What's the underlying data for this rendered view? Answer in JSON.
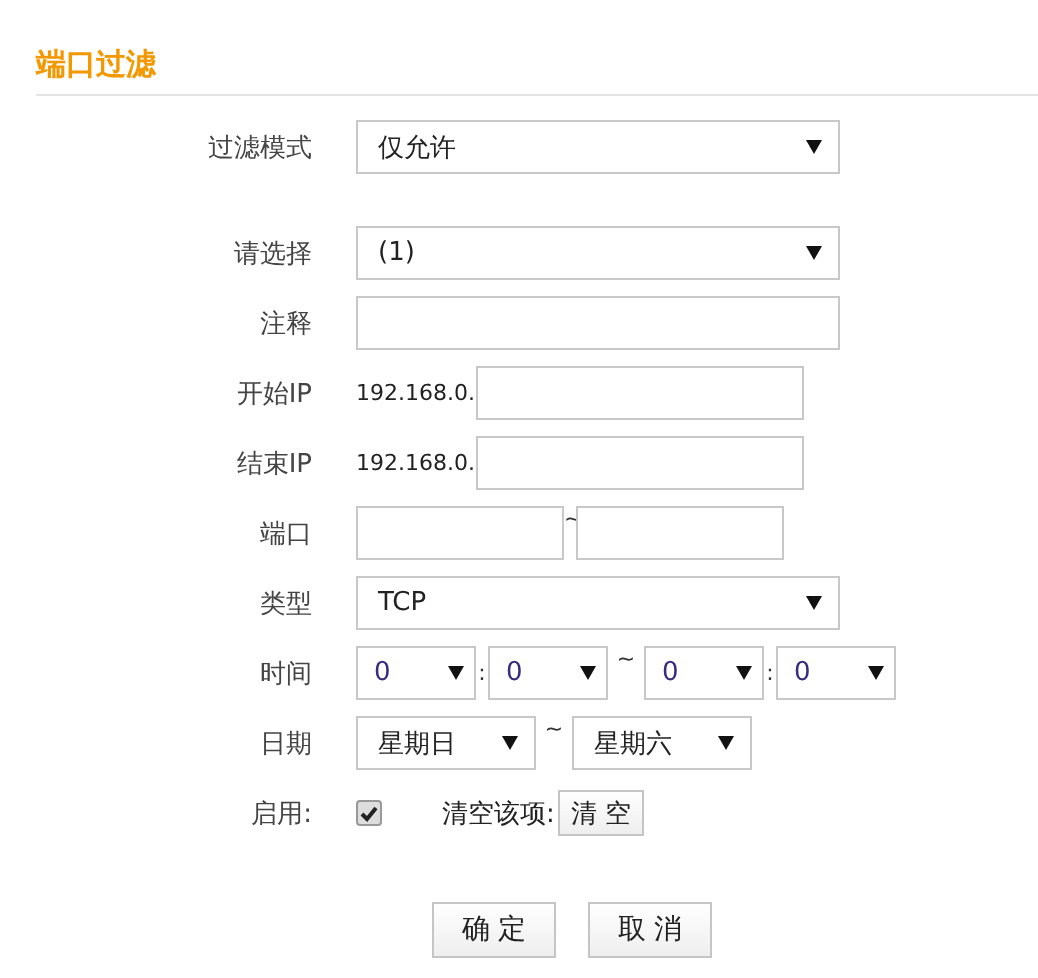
{
  "title": "端口过滤",
  "rows": [
    {
      "kind": "select",
      "label": "过滤模式",
      "value": "仅允许"
    },
    {
      "kind": "select",
      "label": "请选择",
      "value": "(1)"
    },
    {
      "kind": "text",
      "label": "注释"
    },
    {
      "kind": "ip",
      "label": "开始IP",
      "prefix": "192.168.0."
    },
    {
      "kind": "ip",
      "label": "结束IP",
      "prefix": "192.168.0."
    },
    {
      "kind": "range",
      "label": "端口",
      "separator": "~"
    },
    {
      "kind": "select",
      "label": "类型",
      "value": "TCP"
    },
    {
      "kind": "time",
      "label": "时间",
      "selects": [
        "0",
        "0",
        "0",
        "0"
      ],
      "colon": ":",
      "separator": "~"
    },
    {
      "kind": "days",
      "label": "日期",
      "selects": [
        "星期日",
        "星期六"
      ],
      "separator": "~"
    },
    {
      "kind": "enable",
      "label": "启用:",
      "checked": true,
      "clear_label": "清空该项:",
      "clear_button": "清 空"
    }
  ],
  "buttons": [
    "确 定",
    "取 消"
  ]
}
